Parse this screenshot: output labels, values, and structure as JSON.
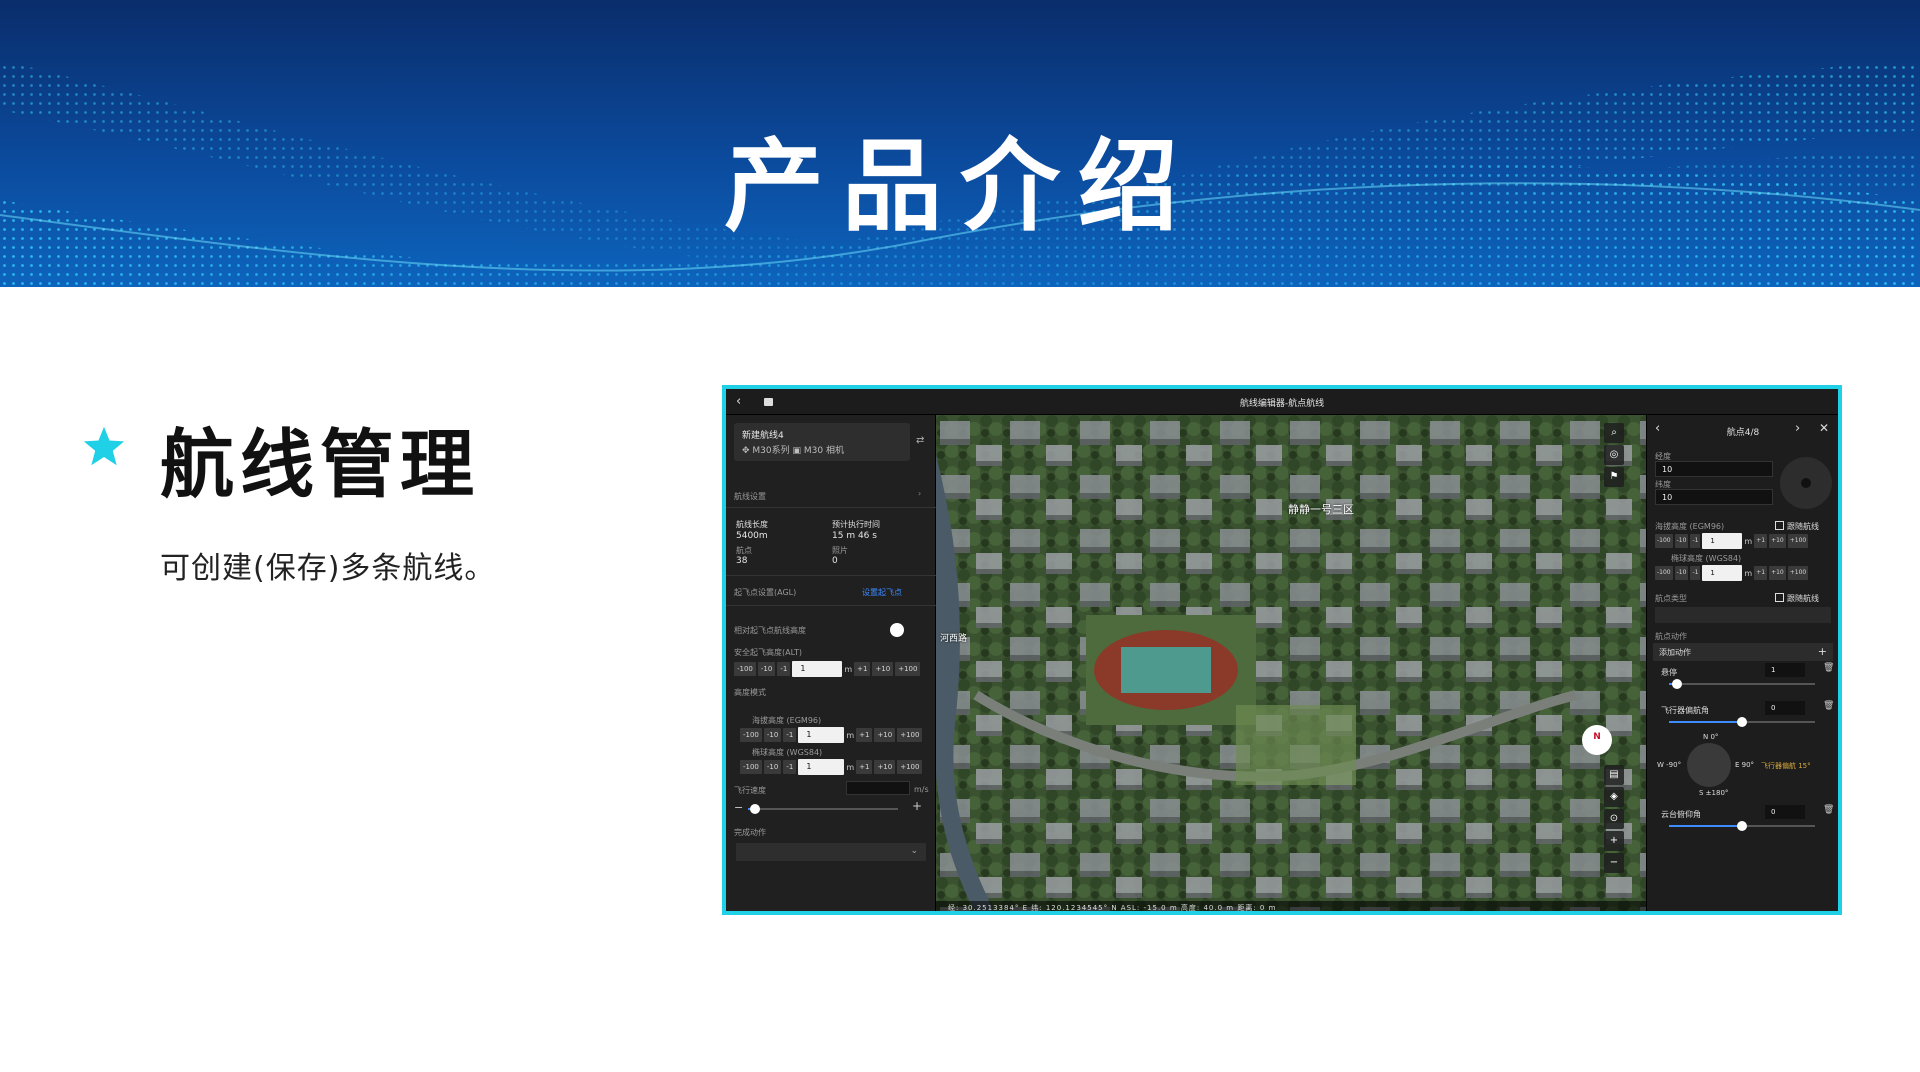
{
  "banner": {
    "title": "产品介绍"
  },
  "section": {
    "title": "航线管理",
    "description": "可创建(保存)多条航线。"
  },
  "colors": {
    "accent": "#1fd0e6",
    "banner_dark": "#0a2d6b",
    "banner_light": "#0d64bd",
    "link_blue": "#3d8bff"
  },
  "app": {
    "window_title": "航线编辑器-航点航线",
    "left_panel": {
      "route_name": "新建航线4",
      "aircraft": "M30系列",
      "camera": "M30 相机",
      "settings_header": "航线设置",
      "length_label": "航线长度",
      "length_value": "5400m",
      "time_label": "预计执行时间",
      "time_value": "15 m 46 s",
      "waypoints_label": "航点",
      "waypoints_value": "38",
      "photos_label": "照片",
      "photos_value": "0",
      "takeoff_label": "起飞点设置(AGL)",
      "takeoff_link": "设置起飞点",
      "toggle_label": "相对起飞点航线高度",
      "safe_alt_label": "安全起飞高度(ALT)",
      "safe_alt_value": "1",
      "route_alt_label": "高度模式",
      "relative_alt_label": "海拔高度 (EGM96)",
      "relative_alt_value": "1",
      "wgs_alt_label": "椭球高度 (WGS84)",
      "wgs_alt_value": "1",
      "speed_label": "飞行速度",
      "speed_unit": "m/s",
      "complete_label": "完成动作",
      "step_minus_100": "-100",
      "step_minus_10": "-10",
      "step_minus_1": "-1",
      "step_plus_1": "+1",
      "step_plus_10": "+10",
      "step_plus_100": "+100",
      "unit_m": "m",
      "dropdown_arrow": "⌄"
    },
    "map": {
      "place_label": "静静一号三区",
      "side_label": "河西路",
      "compass": "N",
      "status": "经: 30.2513384° E   纬: 120.1234545° N   ASL: -15.0 m   高度: 40.0 m   距离: 0 m"
    },
    "right_panel": {
      "title": "航点4/8",
      "lon_label": "经度",
      "lon_value": "10",
      "lat_label": "纬度",
      "lat_value": "10",
      "alt_label": "海拔高度 (EGM96)",
      "follow_label": "跟随航线",
      "alt_value": "1",
      "wgs_label": "椭球高度 (WGS84)",
      "wgs_value": "1",
      "type_label": "航点类型",
      "type_follow": "跟随航线",
      "actions_label": "航点动作",
      "add_action": "添加动作",
      "action1": "悬停",
      "action1_value": "1",
      "action2": "飞行器偏航角",
      "action2_value": "0",
      "heading_n": "N 0°",
      "heading_w": "W -90°",
      "heading_e": "E 90°",
      "heading_s": "S ±180°",
      "heading_note": "飞行器偏航 15°",
      "action3": "云台俯仰角",
      "action3_value": "0"
    }
  }
}
